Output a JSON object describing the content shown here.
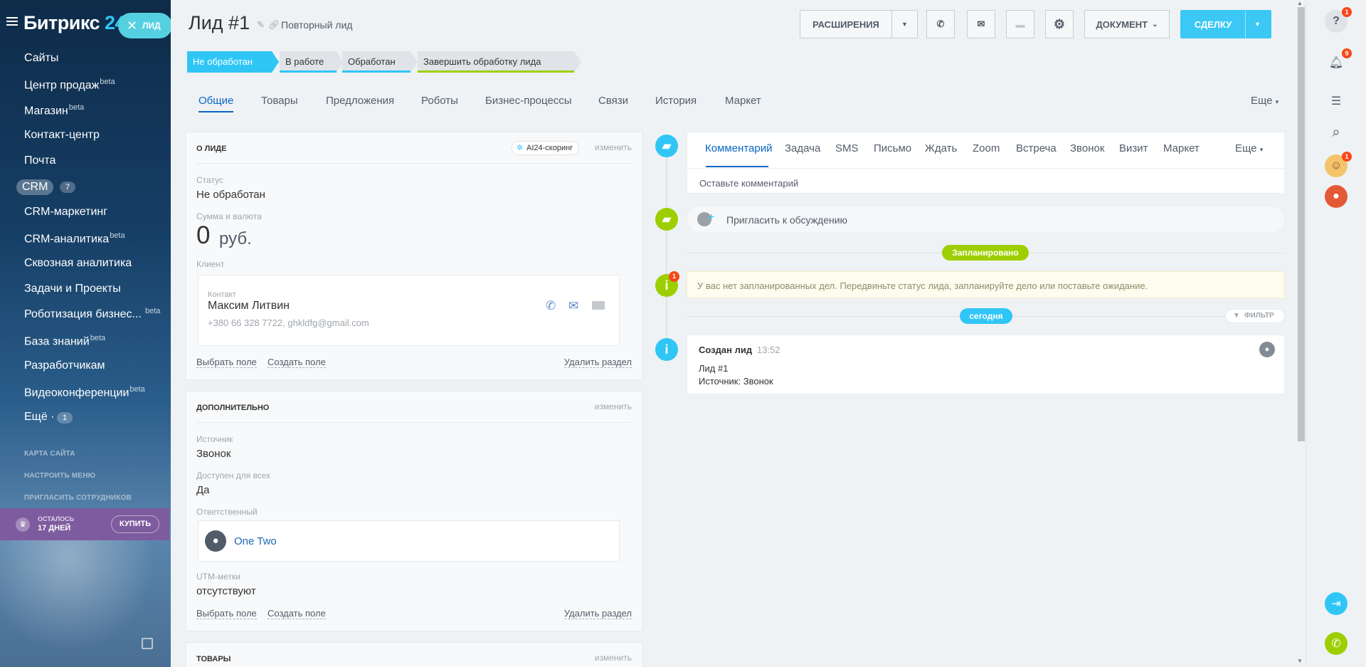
{
  "leftmenu": {
    "logo_main": "Битрикс",
    "logo_num": "24",
    "lead_pill": "ЛИД",
    "items": [
      {
        "label": "Сайты",
        "sup": ""
      },
      {
        "label": "Центр продаж",
        "sup": "beta"
      },
      {
        "label": "Магазин",
        "sup": "beta"
      },
      {
        "label": "Контакт-центр",
        "sup": ""
      },
      {
        "label": "Почта",
        "sup": ""
      },
      {
        "label": "CRM",
        "sup": ""
      },
      {
        "label": "CRM-маркетинг",
        "sup": ""
      },
      {
        "label": "CRM-аналитика",
        "sup": "beta"
      },
      {
        "label": "Сквозная аналитика",
        "sup": ""
      },
      {
        "label": "Задачи и Проекты",
        "sup": ""
      },
      {
        "label": "Роботизация бизнес...",
        "sup": "beta"
      },
      {
        "label": "База знаний",
        "sup": "beta"
      },
      {
        "label": "Разработчикам",
        "sup": ""
      },
      {
        "label": "Видеоконференции",
        "sup": "beta"
      },
      {
        "label": "Ещё ·",
        "sup": ""
      }
    ],
    "crm_count": "7",
    "more_count": "1",
    "links": [
      "КАРТА САЙТА",
      "НАСТРОИТЬ МЕНЮ",
      "ПРИГЛАСИТЬ СОТРУДНИКОВ"
    ],
    "trial_line1": "ОСТАЛОСЬ",
    "trial_line2": "17 ДНЕЙ",
    "buy": "КУПИТЬ"
  },
  "header": {
    "title": "Лид #1",
    "subtitle": "Повторный лид",
    "extensions": "РАСШИРЕНИЯ",
    "document": "ДОКУМЕНТ",
    "deal": "СДЕЛКУ"
  },
  "stages": [
    "Не обработан",
    "В работе",
    "Обработан",
    "Завершить обработку лида"
  ],
  "tabs": [
    "Общие",
    "Товары",
    "Предложения",
    "Роботы",
    "Бизнес-процессы",
    "Связи",
    "История",
    "Маркет"
  ],
  "tabs_more": "Еще",
  "about": {
    "title": "О ЛИДЕ",
    "scoring": "AI24-скоринг",
    "edit": "изменить",
    "status_label": "Статус",
    "status_value": "Не обработан",
    "sum_label": "Сумма и валюта",
    "sum_value": "0",
    "currency": "руб.",
    "client_label": "Клиент",
    "contact_caption": "Контакт",
    "contact_name": "Максим Литвин",
    "contact_info": "+380 66 328 7722, ghkldfg@gmail.com",
    "choose_field": "Выбрать поле",
    "create_field": "Создать поле",
    "delete_section": "Удалить раздел"
  },
  "additional": {
    "title": "ДОПОЛНИТЕЛЬНО",
    "edit": "изменить",
    "source_label": "Источник",
    "source_value": "Звонок",
    "avail_label": "Доступен для всех",
    "avail_value": "Да",
    "resp_label": "Ответственный",
    "resp_value": "One Two",
    "utm_label": "UTM-метки",
    "utm_value": "отсутствуют",
    "choose_field": "Выбрать поле",
    "create_field": "Создать поле",
    "delete_section": "Удалить раздел"
  },
  "goods": {
    "title": "ТОВАРЫ",
    "edit": "изменить"
  },
  "timeline": {
    "tabs": [
      "Комментарий",
      "Задача",
      "SMS",
      "Письмо",
      "Ждать",
      "Zoom",
      "Встреча",
      "Звонок",
      "Визит",
      "Маркет"
    ],
    "more": "Еще",
    "comment_placeholder": "Оставьте комментарий",
    "invite": "Пригласить к обсуждению",
    "planned": "Запланировано",
    "notice": "У вас нет запланированных дел. Передвиньте статус лида, запланируйте дело или поставьте ожидание.",
    "notice_badge": "1",
    "today": "сегодня",
    "filter": "ФИЛЬТР",
    "event_title": "Создан лид",
    "event_time": "13:52",
    "event_line1": "Лид #1",
    "event_line2": "Источник: Звонок"
  },
  "rightbar": {
    "help_badge": "1",
    "bell_badge": "9",
    "avatar_badge": "1"
  },
  "colors": {
    "accent": "#3bc8f5",
    "link": "#0b66c3",
    "green": "#9dcf00",
    "badge": "#f54819"
  }
}
